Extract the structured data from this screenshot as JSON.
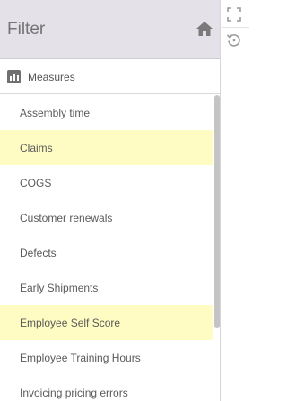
{
  "header": {
    "title": "Filter",
    "home_icon": "home-icon"
  },
  "measures": {
    "label": "Measures",
    "icon": "bar-chart-icon"
  },
  "items": [
    {
      "label": "Assembly time",
      "highlighted": false
    },
    {
      "label": "Claims",
      "highlighted": true
    },
    {
      "label": "COGS",
      "highlighted": false
    },
    {
      "label": "Customer renewals",
      "highlighted": false
    },
    {
      "label": "Defects",
      "highlighted": false
    },
    {
      "label": "Early Shipments",
      "highlighted": false
    },
    {
      "label": "Employee Self Score",
      "highlighted": true
    },
    {
      "label": "Employee Training Hours",
      "highlighted": false
    },
    {
      "label": "Invoicing pricing errors",
      "highlighted": false
    }
  ],
  "side_toolbar": {
    "expand_icon": "expand-icon",
    "reset_icon": "reset-icon"
  },
  "colors": {
    "header_bg": "#e5e1e8",
    "highlight_bg": "#fefcc2",
    "text": "#5a5a5a"
  }
}
